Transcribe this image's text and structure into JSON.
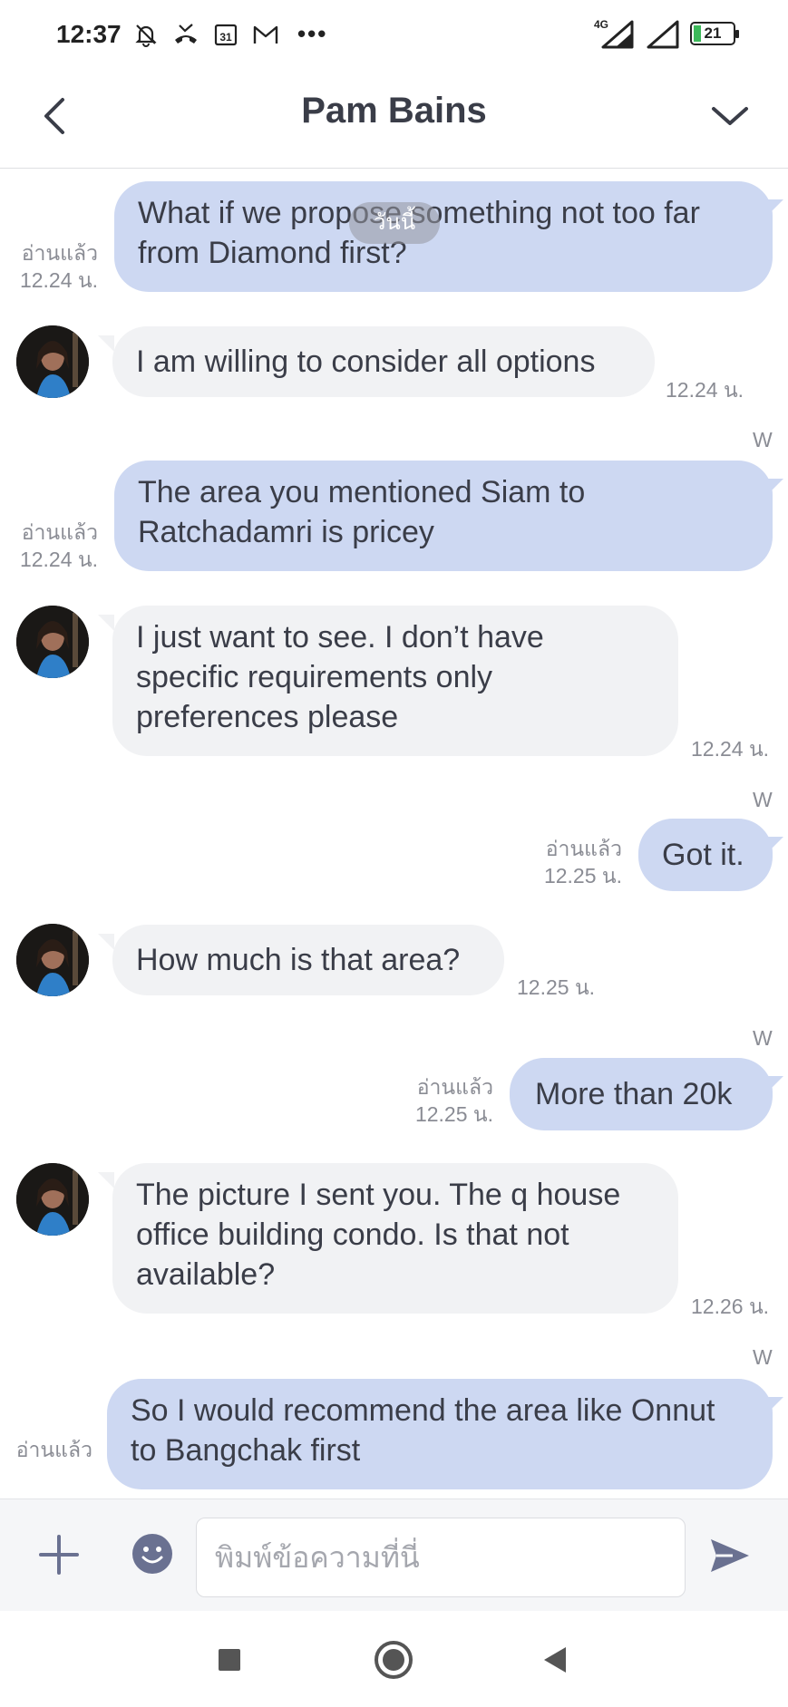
{
  "status_bar": {
    "time": "12:37",
    "calendar_day": "31",
    "more": "•••",
    "network": "4G",
    "battery": "21",
    "icons": [
      "muted-bell-icon",
      "missed-call-icon",
      "calendar-icon",
      "gmail-icon",
      "signal-icon",
      "signal-icon",
      "battery-icon"
    ]
  },
  "header": {
    "title": "Pam Bains",
    "back_icon": "chevron-left-icon",
    "collapse_icon": "chevron-down-icon"
  },
  "date_pill": "วันนี้",
  "messages": [
    {
      "dir": "out",
      "text": "What if we propose something not too far\nfrom Diamond first?",
      "read": "อ่านแล้ว",
      "time": "12.24 น."
    },
    {
      "dir": "in",
      "text": "I am willing to consider all options",
      "time": "12.24 น."
    },
    {
      "dir": "out",
      "text": "The area you mentioned Siam to\nRatchadamri is pricey",
      "read": "อ่านแล้ว",
      "time": "12.24 น.",
      "sender_mark": "W"
    },
    {
      "dir": "in",
      "text": "I just want to see. I don’t have\nspecific requirements only\npreferences please",
      "time": "12.24 น."
    },
    {
      "dir": "out",
      "text": "Got it.",
      "read": "อ่านแล้ว",
      "time": "12.25 น.",
      "sender_mark": "W"
    },
    {
      "dir": "in",
      "text": "How much is that area?",
      "time": "12.25 น."
    },
    {
      "dir": "out",
      "text": "More than 20k",
      "read": "อ่านแล้ว",
      "time": "12.25 น.",
      "sender_mark": "W"
    },
    {
      "dir": "in",
      "text": "The picture I sent you. The q house\noffice building condo. Is that not\navailable?",
      "time": "12.26 น."
    },
    {
      "dir": "out",
      "text": "So I would recommend the area like Onnut\nto Bangchak first",
      "read": "อ่านแล้ว",
      "sender_mark": "W"
    }
  ],
  "input_bar": {
    "placeholder": "พิมพ์ข้อความที่นี่",
    "value": ""
  },
  "colors": {
    "outgoing_bubble": "#cdd8f2",
    "incoming_bubble": "#f1f2f4",
    "send_icon": "#6a7191"
  }
}
